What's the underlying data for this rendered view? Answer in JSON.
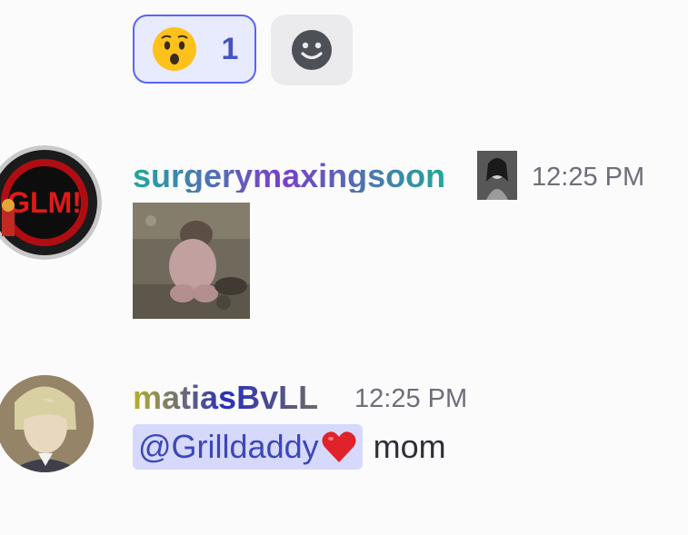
{
  "reactions": [
    {
      "emoji": "hushed-face",
      "count": "1",
      "selected": true
    }
  ],
  "add_reaction": {
    "icon": "smiley-icon"
  },
  "messages": [
    {
      "username": "surgerymaxingsoon",
      "username_gradient": [
        "#1fa89a",
        "#7b3fc9",
        "#1fa89a"
      ],
      "avatar_text": "GLM!",
      "timestamp": "12:25 PM",
      "attachment": "image"
    },
    {
      "username": "matiasBvLL",
      "username_gradient": [
        "#b6b12c",
        "#2a2fb8",
        "#6d6a6a"
      ],
      "timestamp": "12:25 PM",
      "mention": "@Grilldaddy",
      "text": "mom"
    }
  ],
  "colors": {
    "accent": "#5865f2",
    "mention_bg": "#d6d9fb",
    "timestamp": "#6d6f78"
  }
}
